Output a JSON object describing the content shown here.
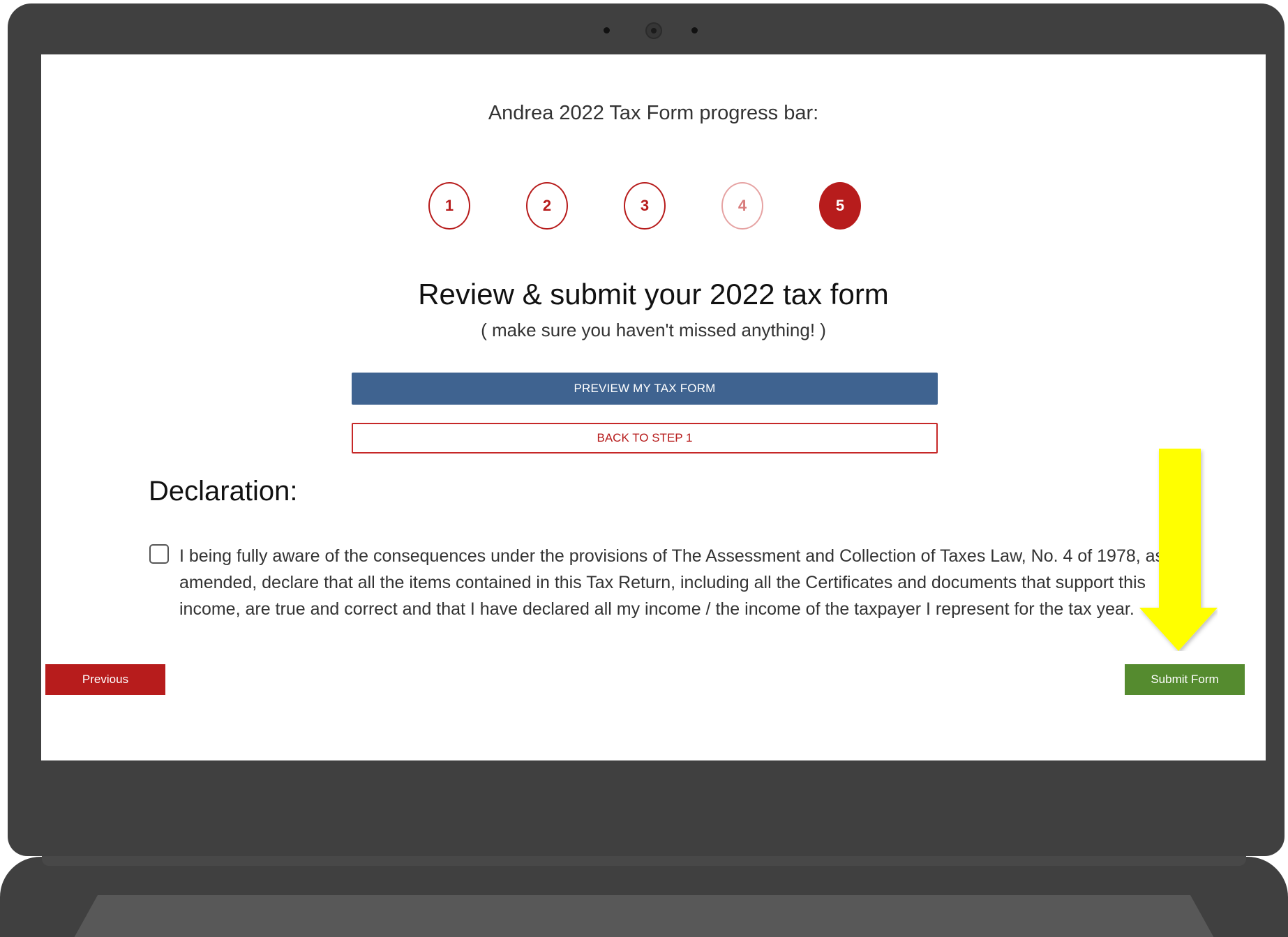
{
  "progress": {
    "title": "Andrea 2022 Tax Form progress bar:",
    "steps": [
      "1",
      "2",
      "3",
      "4",
      "5"
    ],
    "current_step": 5
  },
  "review": {
    "heading": "Review & submit your 2022 tax form",
    "subheading": "( make sure you haven't missed anything! )",
    "preview_button": "PREVIEW MY TAX FORM",
    "back_button": "BACK TO STEP 1"
  },
  "declaration": {
    "heading": "Declaration:",
    "checked": false,
    "text": "I being fully aware of the consequences under the provisions of The Assessment and Collection of Taxes Law, No. 4 of 1978, as amended, declare that all the items contained in this Tax Return, including all the Certificates and documents that support this income, are true and correct and that I have declared all my income / the income of the taxpayer I represent for the tax year."
  },
  "navigation": {
    "previous_button": "Previous",
    "submit_button": "Submit Form"
  },
  "colors": {
    "laptop_frame": "#404040",
    "step_red": "#b71c1c",
    "preview_blue": "#3f6390",
    "submit_green": "#558b2f",
    "annotation_arrow": "#ffff00"
  },
  "icons": {
    "annotation": "down-arrow-icon",
    "checkbox": "checkbox-unchecked-icon"
  }
}
